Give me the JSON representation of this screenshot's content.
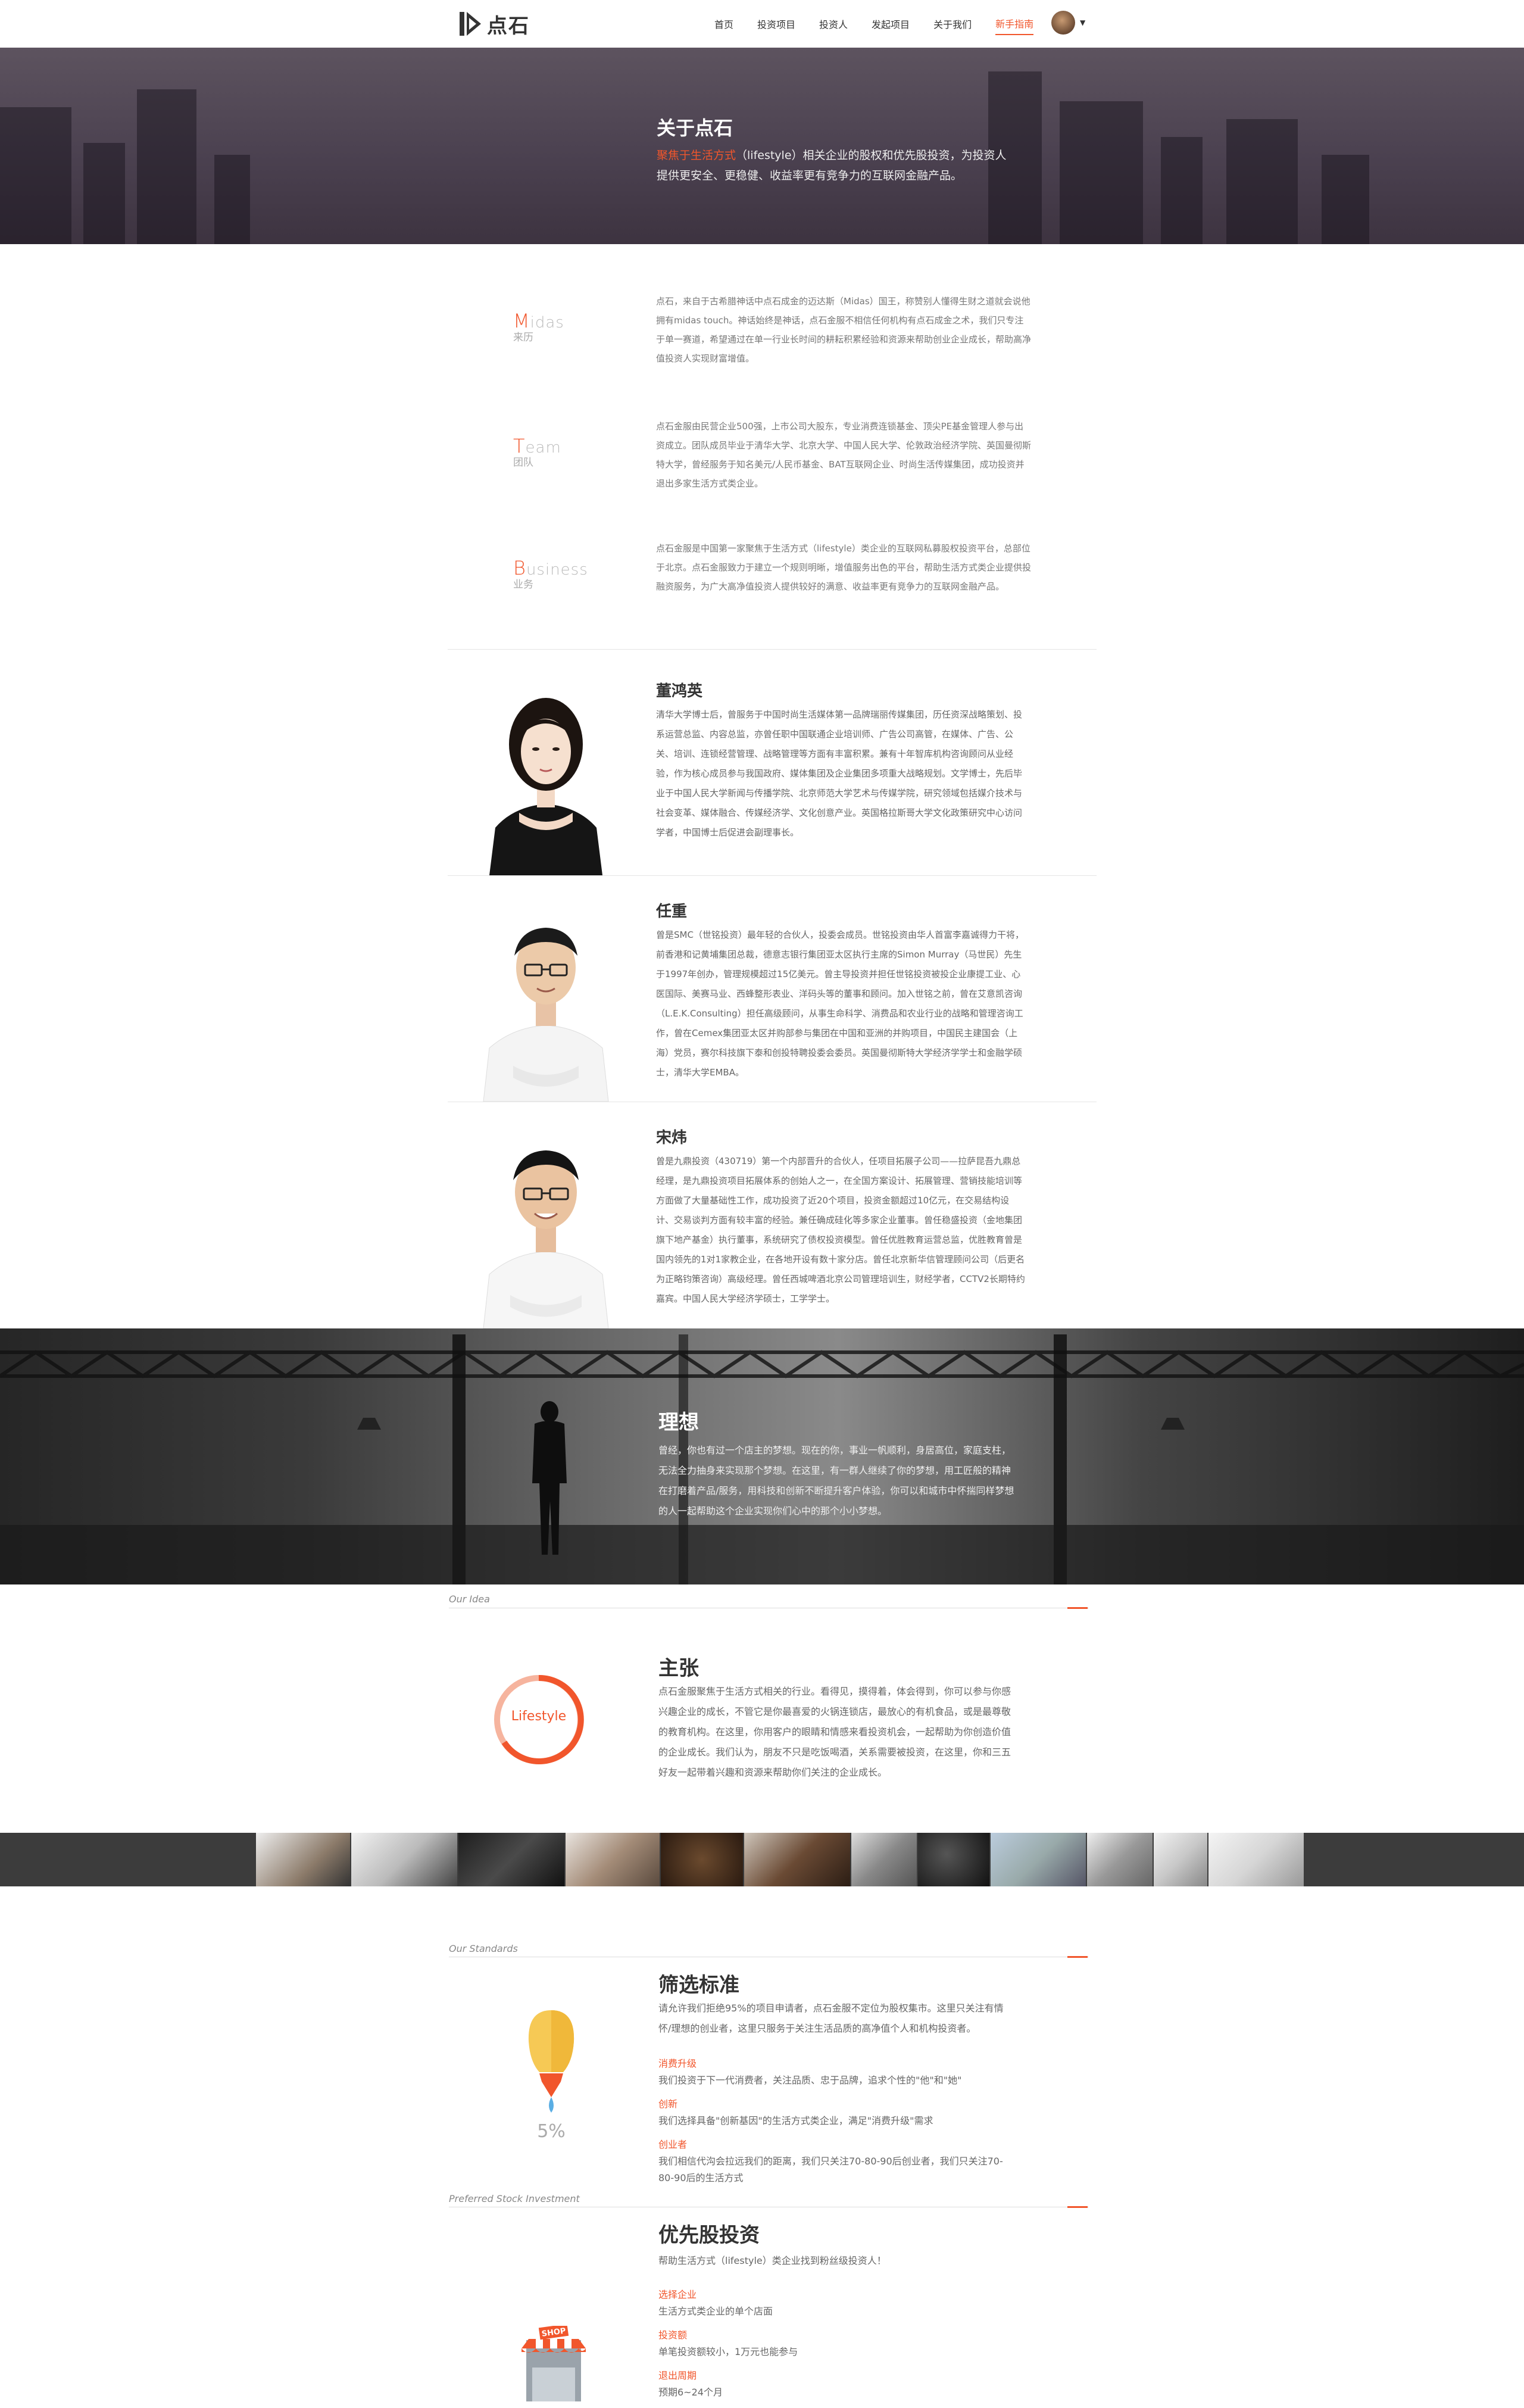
{
  "nav": {
    "logo_text": "点石",
    "items": [
      {
        "label": "首页"
      },
      {
        "label": "投资项目"
      },
      {
        "label": "投资人"
      },
      {
        "label": "发起项目"
      },
      {
        "label": "关于我们"
      },
      {
        "label": "新手指南"
      }
    ]
  },
  "hero": {
    "title": "关于点石",
    "highlight": "聚焦于生活方式",
    "desc": "（lifestyle）相关企业的股权和优先股投资，为投资人提供更安全、更稳健、收益率更有竞争力的互联网金融产品。"
  },
  "intro": [
    {
      "en_first": "M",
      "en_rest": "idas",
      "cn": "来历",
      "text": "点石，来自于古希腊神话中点石成金的迈达斯（Midas）国王，称赞别人懂得生财之道就会说他拥有midas touch。神话始终是神话，点石金服不相信任何机构有点石成金之术，我们只专注于单一赛道，希望通过在单一行业长时间的耕耘积累经验和资源来帮助创业企业成长，帮助高净值投资人实现财富增值。"
    },
    {
      "en_first": "T",
      "en_rest": "eam",
      "cn": "团队",
      "text": "点石金服由民营企业500强，上市公司大股东，专业消费连锁基金、顶尖PE基金管理人参与出资成立。团队成员毕业于清华大学、北京大学、中国人民大学、伦敦政治经济学院、英国曼彻斯特大学，曾经服务于知名美元/人民币基金、BAT互联网企业、时尚生活传媒集团，成功投资并退出多家生活方式类企业。"
    },
    {
      "en_first": "B",
      "en_rest": "usiness",
      "cn": "业务",
      "text": "点石金服是中国第一家聚焦于生活方式（lifestyle）类企业的互联网私募股权投资平台，总部位于北京。点石金服致力于建立一个规则明晰，增值服务出色的平台，帮助生活方式类企业提供投融资服务，为广大高净值投资人提供较好的满意、收益率更有竞争力的互联网金融产品。"
    }
  ],
  "people": [
    {
      "name": "董鸿英",
      "bio": "清华大学博士后，曾服务于中国时尚生活媒体第一品牌瑞丽传媒集团，历任资深战略策划、投系运营总监、内容总监，亦曾任职中国联通企业培训师、广告公司高管，在媒体、广告、公关、培训、连锁经营管理、战略管理等方面有丰富积累。兼有十年智库机构咨询顾问从业经验，作为核心成员参与我国政府、媒体集团及企业集团多项重大战略规划。文学博士，先后毕业于中国人民大学新闻与传播学院、北京师范大学艺术与传媒学院，研究领域包括媒介技术与社会变革、媒体融合、传媒经济学、文化创意产业。英国格拉斯哥大学文化政策研究中心访问学者，中国博士后促进会副理事长。"
    },
    {
      "name": "任重",
      "bio": "曾是SMC（世铭投资）最年轻的合伙人，投委会成员。世铭投资由华人首富李嘉诚得力干将，前香港和记黄埔集团总裁，德意志银行集团亚太区执行主席的Simon Murray（马世民）先生于1997年创办，管理规模超过15亿美元。曾主导投资并担任世铭投资被投企业康提工业、心医国际、美赛马业、西蜂整形表业、洋码头等的董事和顾问。加入世铭之前，曾在艾意凯咨询（L.E.K.Consulting）担任高级顾问，从事生命科学、消费品和农业行业的战略和管理咨询工作，曾在Cemex集团亚太区并购部参与集团在中国和亚洲的并购项目，中国民主建国会（上海）党员，赛尔科技旗下泰和创投特聘投委会委员。英国曼彻斯特大学经济学学士和金融学硕士，清华大学EMBA。"
    },
    {
      "name": "宋炜",
      "bio": "曾是九鼎投资（430719）第一个内部晋升的合伙人，任项目拓展子公司——拉萨昆吾九鼎总经理，是九鼎投资项目拓展体系的创始人之一，在全国方案设计、拓展管理、营销技能培训等方面做了大量基础性工作，成功投资了近20个项目，投资金额超过10亿元，在交易结构设计、交易谈判方面有较丰富的经验。兼任确成硅化等多家企业董事。曾任稳盛投资（金地集团旗下地产基金）执行董事，系统研究了债权投资模型。曾任优胜教育运营总监，优胜教育曾是国内领先的1对1家教企业，在各地开设有数十家分店。曾任北京新华信管理顾问公司（后更名为正略钧策咨询）高级经理。曾任西城啤酒北京公司管理培训生，财经学者，CCTV2长期特约嘉宾。中国人民大学经济学硕士，工学学士。"
    }
  ],
  "ideal": {
    "title": "理想",
    "text": "曾经，你也有过一个店主的梦想。现在的你，事业一帆顺利，身居高位，家庭支柱，无法全力抽身来实现那个梦想。在这里，有一群人继续了你的梦想，用工匠般的精神在打磨着产品/服务，用科技和创新不断提升客户体验，你可以和城市中怀揣同样梦想的人一起帮助这个企业实现你们心中的那个小小梦想。"
  },
  "idea": {
    "label": "Our Idea",
    "title": "主张",
    "ring_text": "Lifestyle",
    "text": "点石金服聚焦于生活方式相关的行业。看得见，摸得着，体会得到，你可以参与你感兴趣企业的成长，不管它是你最喜爱的火锅连锁店，最放心的有机食品，或是最尊敬的教育机构。在这里，你用客户的眼睛和情感来看投资机会，一起帮助为你创造价值的企业成长。我们认为，朋友不只是吃饭喝酒，关系需要被投资，在这里，你和三五好友一起带着兴趣和资源来帮助你们关注的企业成长。"
  },
  "standards": {
    "label": "Our Standards",
    "title": "筛选标准",
    "percent": "5%",
    "intro": "请允许我们拒绝95%的项目申请者，点石金服不定位为股权集市。这里只关注有情怀/理想的创业者，这里只服务于关注生活品质的高净值个人和机构投资者。",
    "items": [
      {
        "title": "消费升级",
        "text": "我们投资于下一代消费者，关注品质、忠于品牌，追求个性的\"他\"和\"她\""
      },
      {
        "title": "创新",
        "text": "我们选择具备\"创新基因\"的生活方式类企业，满足\"消费升级\"需求"
      },
      {
        "title": "创业者",
        "text": "我们相信代沟会拉远我们的距离，我们只关注70-80-90后创业者，我们只关注70-80-90后的生活方式"
      }
    ]
  },
  "preferred": {
    "label": "Preferred Stock Investment",
    "title": "优先股投资",
    "intro": "帮助生活方式（lifestyle）类企业找到粉丝级投资人！",
    "shop_sign": "SHOP",
    "items": [
      {
        "title": "选择企业",
        "text": "生活方式类企业的单个店面"
      },
      {
        "title": "投资额",
        "text": "单笔投资额较小，1万元也能参与"
      },
      {
        "title": "退出周期",
        "text": "预期6~24个月"
      }
    ]
  }
}
